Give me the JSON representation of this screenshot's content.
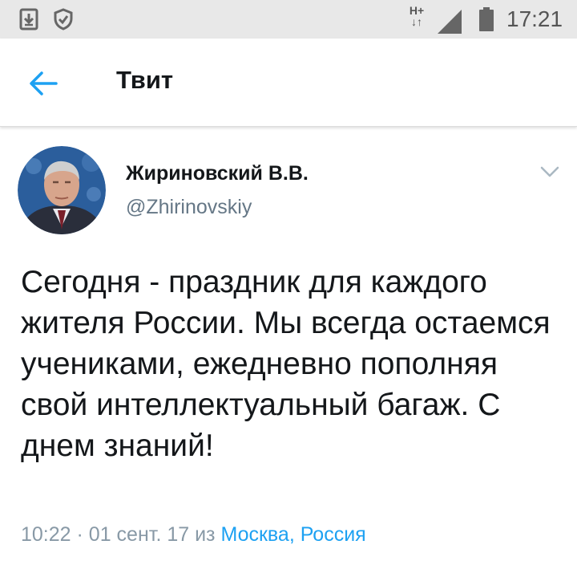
{
  "status_bar": {
    "network_type": "H+",
    "time": "17:21",
    "icons": [
      "download-icon",
      "shield-check-icon",
      "network-arrows-icon",
      "signal-icon",
      "battery-icon"
    ]
  },
  "header": {
    "title": "Твит",
    "back_icon": "arrow-left-icon"
  },
  "tweet": {
    "author_name": "Жириновский В.В.",
    "author_handle": "@Zhirinovskiy",
    "text": "Сегодня - праздник для каждого жителя России. Мы всегда остаемся учениками, ежедневно пополняя свой интеллектуальный багаж. С днем знаний!",
    "time": "10:22",
    "separator": "·",
    "date": "01 сент. 17",
    "from_label": "из",
    "location": "Москва, Россия"
  },
  "colors": {
    "accent": "#1da1f2",
    "text_primary": "#14171a",
    "text_secondary": "#657786",
    "meta_gray": "#8899a6",
    "status_bar_bg": "#e8e8e8"
  }
}
